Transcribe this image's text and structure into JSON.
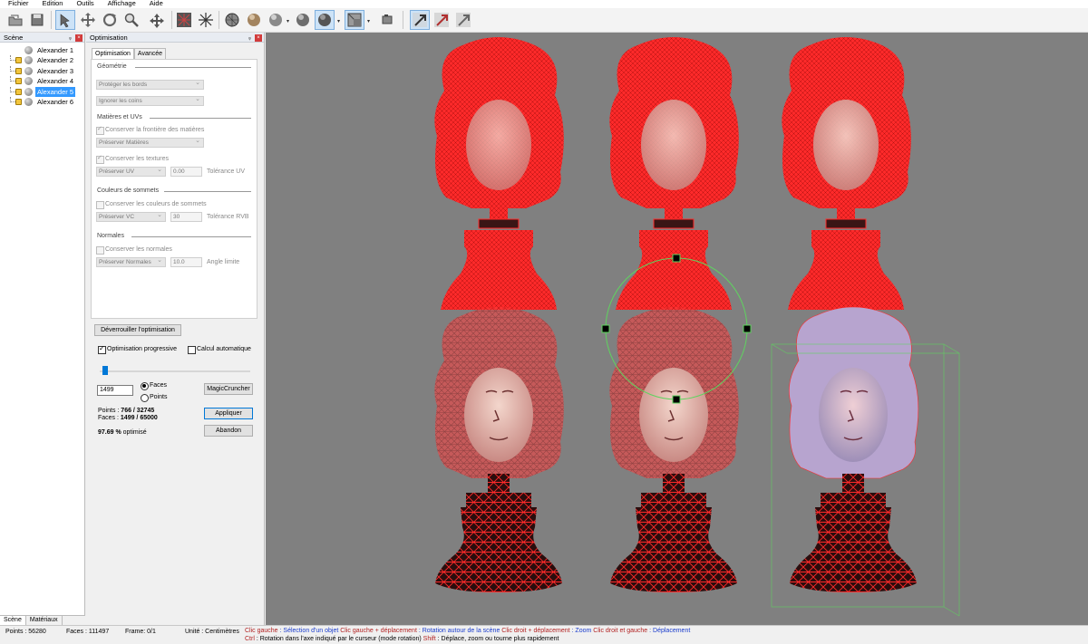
{
  "menu": [
    "Fichier",
    "Edition",
    "Outils",
    "Affichage",
    "Aide"
  ],
  "toolbar": {
    "tools": [
      "open-icon",
      "save-icon",
      "select-arrow-icon",
      "move-icon",
      "rotate-icon",
      "zoom-icon",
      "pan-icon",
      "wireframe-sphere-icon",
      "axis-icon",
      "wire-shaded-icon",
      "smooth-shaded-icon",
      "flat-shaded-icon",
      "textured-shaded-icon",
      "shaded-wire-icon",
      "texture-icon",
      "camera-icon",
      "select-normal-icon",
      "select-red-icon",
      "select-gray-icon"
    ]
  },
  "scene": {
    "title": "Scène",
    "items": [
      {
        "label": "Alexander 1",
        "locked": false,
        "selected": false
      },
      {
        "label": "Alexander 2",
        "locked": true,
        "selected": false
      },
      {
        "label": "Alexander 3",
        "locked": true,
        "selected": false
      },
      {
        "label": "Alexander 4",
        "locked": true,
        "selected": false
      },
      {
        "label": "Alexander 5",
        "locked": true,
        "selected": true
      },
      {
        "label": "Alexander 6",
        "locked": true,
        "selected": false
      }
    ],
    "tabs": [
      "Scène",
      "Matériaux"
    ]
  },
  "optimisation": {
    "title": "Optimisation",
    "tabs": [
      "Optimisation",
      "Avancée"
    ],
    "geometry_label": "Géométrie",
    "protect_borders": "Protéger les bords",
    "ignore_corners": "Ignorer les coins",
    "materials_label": "Matières et UVs",
    "keep_material_border": "Conserver la frontière des matières",
    "preserve_materials": "Préserver Matières",
    "keep_textures": "Conserver les textures",
    "preserve_uv": "Préserver UV",
    "uv_tolerance": "0.00",
    "uv_tolerance_label": "Tolérance UV",
    "vertex_colors_label": "Couleurs de sommets",
    "keep_vertex_colors": "Conserver les couleurs de sommets",
    "preserve_vc": "Préserver VC",
    "rgb_tolerance": "30",
    "rgb_tolerance_label": "Tolérance RVB",
    "normals_label": "Normales",
    "keep_normals": "Conserver les normales",
    "preserve_normals": "Préserver Normales",
    "angle_limit": "10.0",
    "angle_limit_label": "Angle limite",
    "unlock_button": "Déverrouiller l'optimisation",
    "progressive": "Optimisation progressive",
    "auto_calc": "Calcul automatique",
    "slider_fraction": 0.02,
    "target_value": "1499",
    "radio_faces": "Faces",
    "radio_points": "Points",
    "magiccruncher": "MagicCruncher",
    "points_label": "Points : ",
    "points_value": "766 / 32745",
    "faces_label": "Faces : ",
    "faces_value": "1499 / 65000",
    "apply_button": "Appliquer",
    "cancel_button": "Abandon",
    "optimised_value": "97.69 %",
    "optimised_label": " optimisé"
  },
  "status": {
    "points": "Points : 56280",
    "faces": "Faces : 111497",
    "frame": "Frame: 0/1",
    "unit": "Unité : Centimètres",
    "hint1": [
      {
        "k": "Clic gauche",
        "a": " : Sélection d'un objet "
      },
      {
        "k": "Clic gauche + déplacement",
        "a": " : Rotation autour de la scène "
      },
      {
        "k": "Clic droit + déplacement",
        "a": " : Zoom "
      },
      {
        "k": "Clic droit et gauche",
        "a": " : Déplacement"
      }
    ],
    "hint2": [
      {
        "k": "Ctrl",
        "a": " : Rotation dans l'axe indiqué par le curseur (mode rotation) "
      },
      {
        "k": "Shift",
        "a": " : Déplace, zoom ou tourne plus rapidement"
      }
    ]
  },
  "colors": {
    "viewport_bg": "#808080",
    "wire_red": "#ff2a2a",
    "selection": "#3399ff",
    "gizmo_green": "#5fd35f"
  }
}
